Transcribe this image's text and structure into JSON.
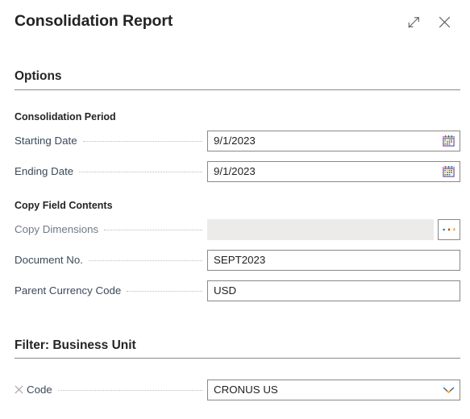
{
  "window": {
    "title": "Consolidation Report",
    "expand_icon": "expand-diagonal-icon",
    "close_icon": "close-icon"
  },
  "options_section": {
    "header": "Options",
    "groups": [
      {
        "heading": "Consolidation Period",
        "fields": [
          {
            "label": "Starting Date",
            "value": "9/1/2023",
            "icon": "calendar-icon",
            "control": "date"
          },
          {
            "label": "Ending Date",
            "value": "9/1/2023",
            "icon": "calendar-icon",
            "control": "date"
          }
        ]
      },
      {
        "heading": "Copy Field Contents",
        "fields": [
          {
            "label": "Copy Dimensions",
            "value": "",
            "icon": "ellipsis-icon",
            "control": "lookup",
            "state": "readonly"
          },
          {
            "label": "Document No.",
            "value": "SEPT2023",
            "control": "text"
          },
          {
            "label": "Parent Currency Code",
            "value": "USD",
            "control": "text"
          }
        ]
      }
    ]
  },
  "filter_section": {
    "header": "Filter: Business Unit",
    "fields": [
      {
        "remove_icon": "remove-filter-x-icon",
        "label": "Code",
        "value": "CRONUS US",
        "icon": "chevron-down-icon",
        "control": "dropdown"
      }
    ]
  },
  "colors": {
    "title_text": "#252423",
    "label_text": "#3b4a5b",
    "value_text": "#201f1e",
    "border": "#8a8886",
    "readonly_bg": "#edebe9",
    "leader_dots": "#b9bcc0",
    "icon_grey": "#605e5c"
  }
}
